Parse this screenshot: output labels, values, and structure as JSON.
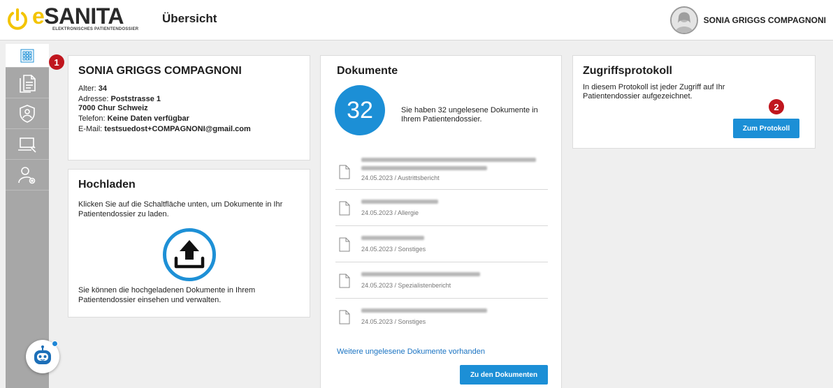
{
  "header": {
    "logo_word": "SANITA",
    "logo_letter": "e",
    "logo_sub": "ELEKTRONISCHES PATIENTENDOSSIER",
    "page_title": "Übersicht",
    "user_name": "SONIA GRIGGS COMPAGNONI"
  },
  "sidebar": {
    "items": [
      {
        "icon": "grid-icon",
        "active": true
      },
      {
        "icon": "documents-icon"
      },
      {
        "icon": "shield-user-icon"
      },
      {
        "icon": "laptop-settings-icon"
      },
      {
        "icon": "user-settings-icon"
      }
    ],
    "chatbot_icon": "chatbot-icon"
  },
  "patient": {
    "name": "SONIA GRIGGS COMPAGNONI",
    "age_label": "Alter:",
    "age": "34",
    "address_label": "Adresse:",
    "street": "Poststrasse 1",
    "city": "7000 Chur Schweiz",
    "phone_label": "Telefon:",
    "phone": "Keine Daten verfügbar",
    "email_label": "E-Mail:",
    "email": "testsuedost+COMPAGNONI@gmail.com",
    "badge": "1"
  },
  "upload": {
    "title": "Hochladen",
    "text_top": "Klicken Sie auf die Schaltfläche unten, um Dokumente in Ihr Patientendossier zu laden.",
    "text_bottom": "Sie können die hochgeladenen Dokumente in Ihrem Patientendossier einsehen und verwalten."
  },
  "documents": {
    "title": "Dokumente",
    "unread_count": "32",
    "unread_text": "Sie haben 32 ungelesene Dokumente in Ihrem Patientendossier.",
    "items": [
      {
        "meta": "24.05.2023 / Austrittsbericht"
      },
      {
        "meta": "24.05.2023 / Allergie"
      },
      {
        "meta": "24.05.2023 / Sonstiges"
      },
      {
        "meta": "24.05.2023 / Spezialistenbericht"
      },
      {
        "meta": "24.05.2023 / Sonstiges"
      }
    ],
    "more_link": "Weitere ungelesene Dokumente vorhanden",
    "button": "Zu den Dokumenten"
  },
  "protocol": {
    "title": "Zugriffsprotokoll",
    "text": "In diesem Protokoll ist jeder Zugriff auf Ihr Patientendossier aufgezeichnet.",
    "button": "Zum Protokoll",
    "badge": "2"
  },
  "colors": {
    "accent_blue": "#1c8fd6",
    "logo_yellow": "#f3c400",
    "badge_red": "#c0161e",
    "sidebar_grey": "#a7a7a7"
  }
}
